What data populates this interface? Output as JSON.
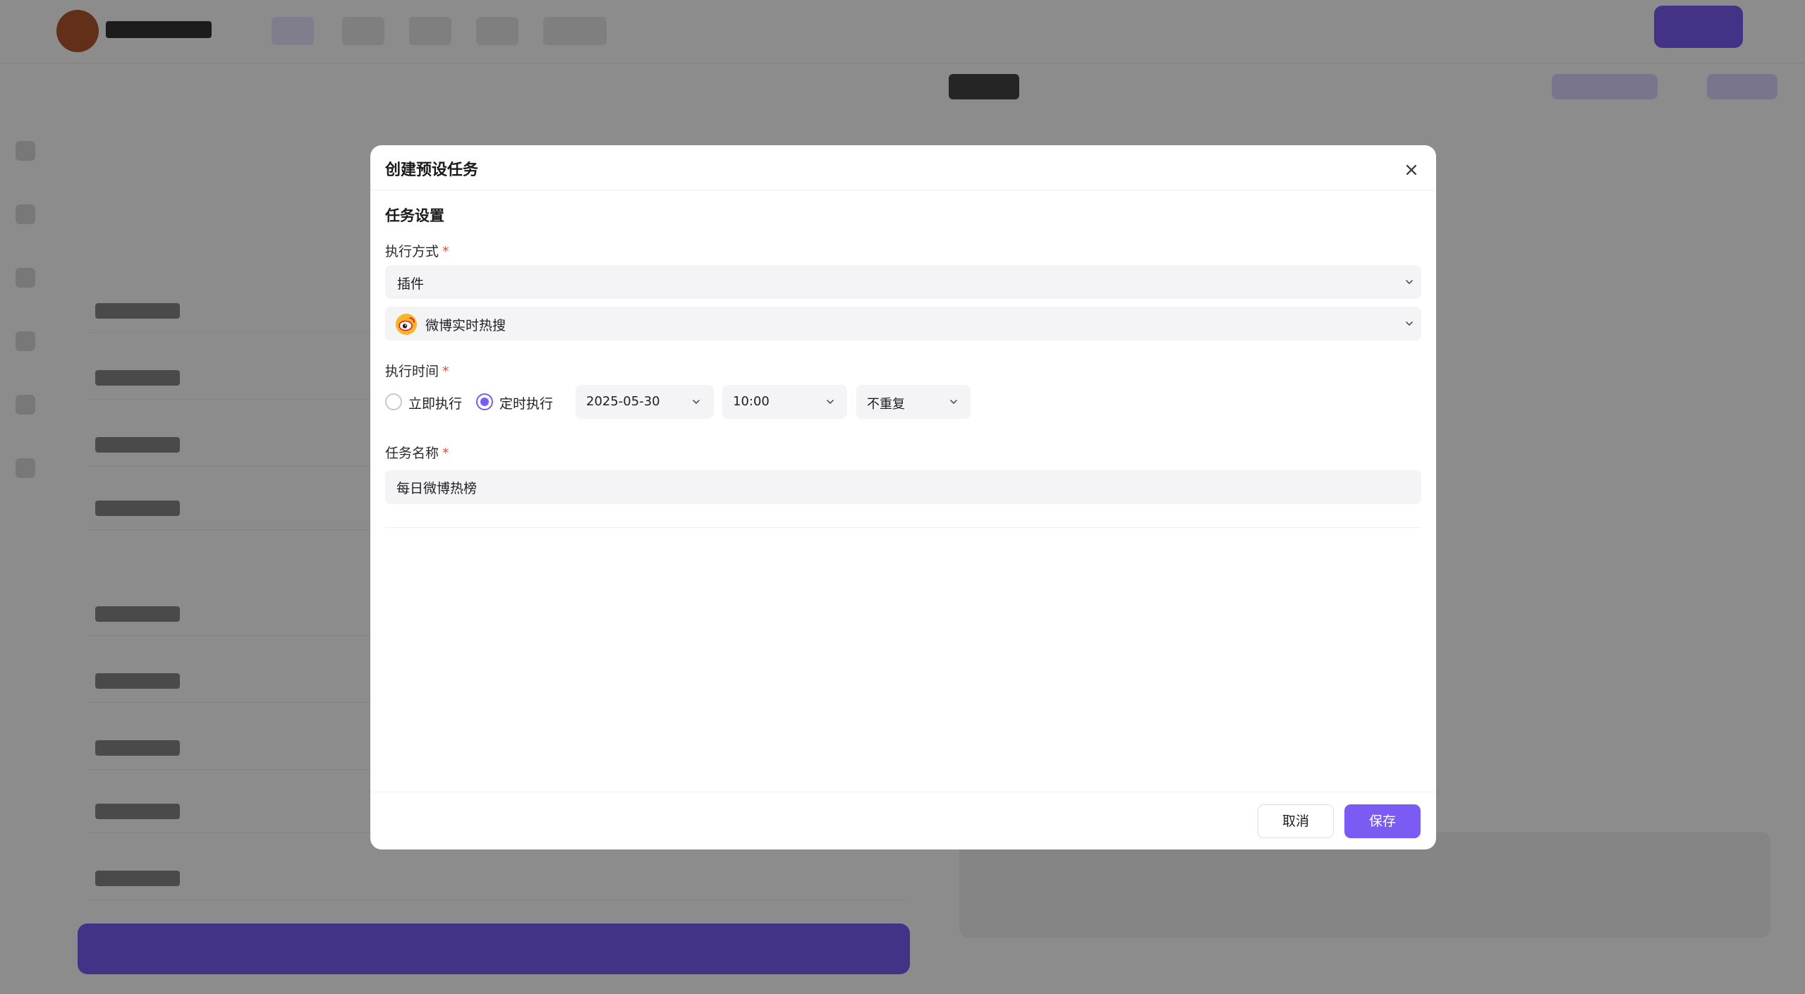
{
  "modal": {
    "title": "创建预设任务",
    "section_title": "任务设置",
    "execution_method": {
      "label": "执行方式",
      "required_mark": "*",
      "selected": "插件"
    },
    "plugin": {
      "selected": "微博实时热搜",
      "icon": "weibo-icon"
    },
    "execution_time": {
      "label": "执行时间",
      "required_mark": "*",
      "options": [
        "立即执行",
        "定时执行"
      ],
      "selected_option": "定时执行",
      "date": "2025-05-30",
      "time": "10:00",
      "repeat": "不重复"
    },
    "task_name": {
      "label": "任务名称",
      "required_mark": "*",
      "value": "每日微博热榜"
    },
    "buttons": {
      "cancel": "取消",
      "save": "保存"
    }
  },
  "colors": {
    "accent": "#7a5cf5",
    "required": "#f0453a",
    "input_bg": "#f4f4f6"
  }
}
